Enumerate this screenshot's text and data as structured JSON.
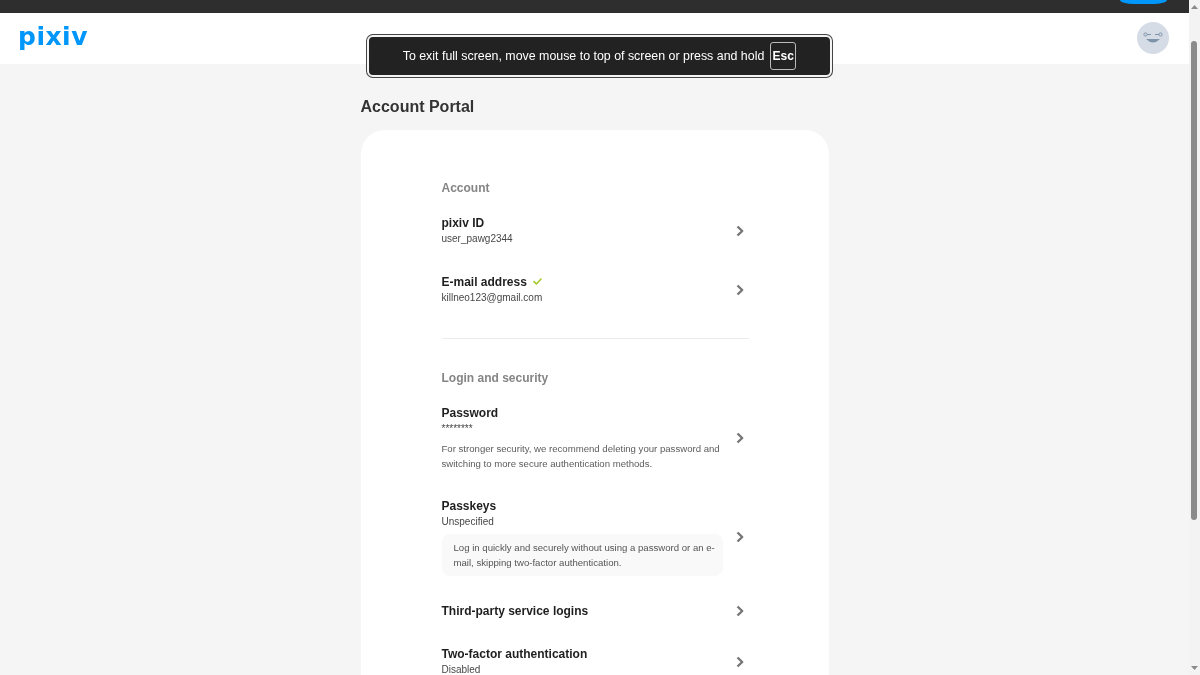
{
  "browser": {
    "fullscreen_notice": {
      "text": "To exit full screen, move mouse to top of screen or press and hold",
      "key": "Esc"
    }
  },
  "header": {
    "logo": "pixiv"
  },
  "page_title": "Account Portal",
  "sections": [
    {
      "heading": "Account",
      "items": [
        {
          "title": "pixiv ID",
          "verified": false,
          "value": "user_pawg2344"
        },
        {
          "title": "E-mail address",
          "verified": true,
          "value": "killneo123@gmail.com"
        }
      ]
    },
    {
      "heading": "Login and security",
      "items": [
        {
          "title": "Password",
          "verified": false,
          "value": "********",
          "description": "For stronger security, we recommend deleting your password and switching to more secure authentication methods."
        },
        {
          "title": "Passkeys",
          "verified": false,
          "value": "Unspecified",
          "note": "Log in quickly and securely without using a password or an e-mail, skipping two-factor authentication."
        },
        {
          "title": "Third-party service logins",
          "verified": false
        },
        {
          "title": "Two-factor authentication",
          "verified": false,
          "value": "Disabled"
        }
      ]
    }
  ]
}
